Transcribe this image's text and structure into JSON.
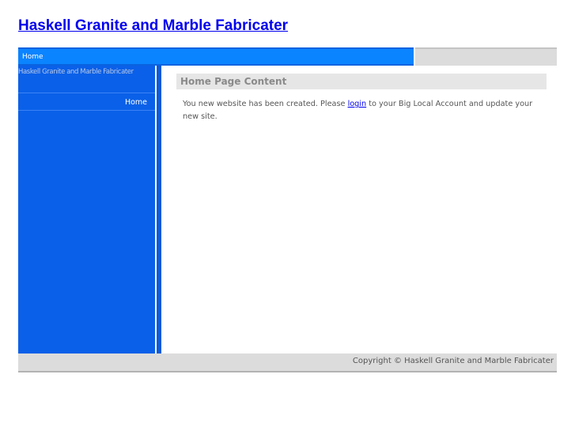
{
  "site": {
    "title": "Haskell Granite and Marble Fabricater"
  },
  "topnav": {
    "items": [
      {
        "label": "Home"
      }
    ]
  },
  "sidebar": {
    "heading": "Haskell Granite and Marble Fabricater",
    "items": [
      {
        "label": "Home"
      }
    ]
  },
  "content": {
    "heading": "Home Page Content",
    "body_before": "You new website has been created. Please ",
    "login_link": "login",
    "body_after": " to your Big Local Account and update your new site."
  },
  "footer": {
    "copyright": "Copyright © Haskell Granite and Marble Fabricater"
  },
  "colors": {
    "title_link": "#0000ee",
    "nav_blue": "#0b84ff",
    "sidebar_blue": "#0a60e8",
    "footer_gray": "#dcdcdc"
  }
}
